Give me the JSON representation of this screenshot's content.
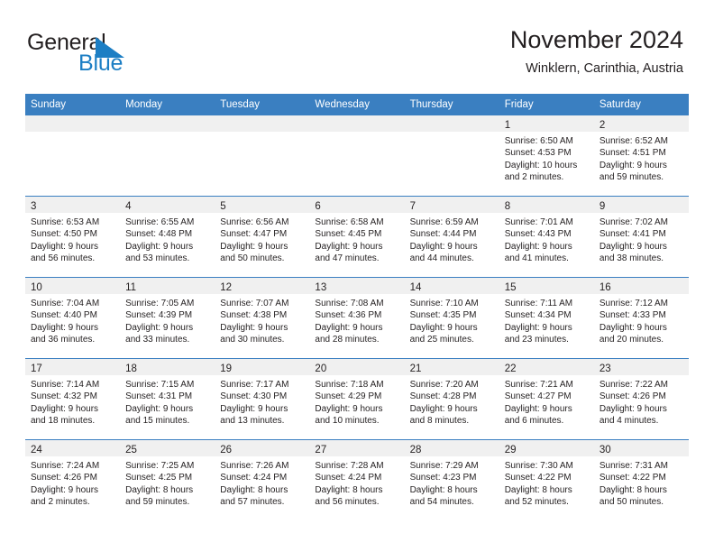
{
  "brand": {
    "name_part1": "General",
    "name_part2": "Blue",
    "accent_color": "#1c7ec4",
    "logo_icon": "triangle-flag-icon"
  },
  "header": {
    "title": "November 2024",
    "subtitle": "Winklern, Carinthia, Austria"
  },
  "theme": {
    "header_row_bg": "#3a7fc1",
    "daynum_band_bg": "#f0f0f0",
    "text_color": "#231f20"
  },
  "weekdays": [
    "Sunday",
    "Monday",
    "Tuesday",
    "Wednesday",
    "Thursday",
    "Friday",
    "Saturday"
  ],
  "labels": {
    "sunrise": "Sunrise:",
    "sunset": "Sunset:",
    "daylight": "Daylight:"
  },
  "weeks": [
    [
      {
        "day": "",
        "sunrise": "",
        "sunset": "",
        "daylight_1": "",
        "daylight_2": ""
      },
      {
        "day": "",
        "sunrise": "",
        "sunset": "",
        "daylight_1": "",
        "daylight_2": ""
      },
      {
        "day": "",
        "sunrise": "",
        "sunset": "",
        "daylight_1": "",
        "daylight_2": ""
      },
      {
        "day": "",
        "sunrise": "",
        "sunset": "",
        "daylight_1": "",
        "daylight_2": ""
      },
      {
        "day": "",
        "sunrise": "",
        "sunset": "",
        "daylight_1": "",
        "daylight_2": ""
      },
      {
        "day": "1",
        "sunrise": "Sunrise: 6:50 AM",
        "sunset": "Sunset: 4:53 PM",
        "daylight_1": "Daylight: 10 hours",
        "daylight_2": "and 2 minutes."
      },
      {
        "day": "2",
        "sunrise": "Sunrise: 6:52 AM",
        "sunset": "Sunset: 4:51 PM",
        "daylight_1": "Daylight: 9 hours",
        "daylight_2": "and 59 minutes."
      }
    ],
    [
      {
        "day": "3",
        "sunrise": "Sunrise: 6:53 AM",
        "sunset": "Sunset: 4:50 PM",
        "daylight_1": "Daylight: 9 hours",
        "daylight_2": "and 56 minutes."
      },
      {
        "day": "4",
        "sunrise": "Sunrise: 6:55 AM",
        "sunset": "Sunset: 4:48 PM",
        "daylight_1": "Daylight: 9 hours",
        "daylight_2": "and 53 minutes."
      },
      {
        "day": "5",
        "sunrise": "Sunrise: 6:56 AM",
        "sunset": "Sunset: 4:47 PM",
        "daylight_1": "Daylight: 9 hours",
        "daylight_2": "and 50 minutes."
      },
      {
        "day": "6",
        "sunrise": "Sunrise: 6:58 AM",
        "sunset": "Sunset: 4:45 PM",
        "daylight_1": "Daylight: 9 hours",
        "daylight_2": "and 47 minutes."
      },
      {
        "day": "7",
        "sunrise": "Sunrise: 6:59 AM",
        "sunset": "Sunset: 4:44 PM",
        "daylight_1": "Daylight: 9 hours",
        "daylight_2": "and 44 minutes."
      },
      {
        "day": "8",
        "sunrise": "Sunrise: 7:01 AM",
        "sunset": "Sunset: 4:43 PM",
        "daylight_1": "Daylight: 9 hours",
        "daylight_2": "and 41 minutes."
      },
      {
        "day": "9",
        "sunrise": "Sunrise: 7:02 AM",
        "sunset": "Sunset: 4:41 PM",
        "daylight_1": "Daylight: 9 hours",
        "daylight_2": "and 38 minutes."
      }
    ],
    [
      {
        "day": "10",
        "sunrise": "Sunrise: 7:04 AM",
        "sunset": "Sunset: 4:40 PM",
        "daylight_1": "Daylight: 9 hours",
        "daylight_2": "and 36 minutes."
      },
      {
        "day": "11",
        "sunrise": "Sunrise: 7:05 AM",
        "sunset": "Sunset: 4:39 PM",
        "daylight_1": "Daylight: 9 hours",
        "daylight_2": "and 33 minutes."
      },
      {
        "day": "12",
        "sunrise": "Sunrise: 7:07 AM",
        "sunset": "Sunset: 4:38 PM",
        "daylight_1": "Daylight: 9 hours",
        "daylight_2": "and 30 minutes."
      },
      {
        "day": "13",
        "sunrise": "Sunrise: 7:08 AM",
        "sunset": "Sunset: 4:36 PM",
        "daylight_1": "Daylight: 9 hours",
        "daylight_2": "and 28 minutes."
      },
      {
        "day": "14",
        "sunrise": "Sunrise: 7:10 AM",
        "sunset": "Sunset: 4:35 PM",
        "daylight_1": "Daylight: 9 hours",
        "daylight_2": "and 25 minutes."
      },
      {
        "day": "15",
        "sunrise": "Sunrise: 7:11 AM",
        "sunset": "Sunset: 4:34 PM",
        "daylight_1": "Daylight: 9 hours",
        "daylight_2": "and 23 minutes."
      },
      {
        "day": "16",
        "sunrise": "Sunrise: 7:12 AM",
        "sunset": "Sunset: 4:33 PM",
        "daylight_1": "Daylight: 9 hours",
        "daylight_2": "and 20 minutes."
      }
    ],
    [
      {
        "day": "17",
        "sunrise": "Sunrise: 7:14 AM",
        "sunset": "Sunset: 4:32 PM",
        "daylight_1": "Daylight: 9 hours",
        "daylight_2": "and 18 minutes."
      },
      {
        "day": "18",
        "sunrise": "Sunrise: 7:15 AM",
        "sunset": "Sunset: 4:31 PM",
        "daylight_1": "Daylight: 9 hours",
        "daylight_2": "and 15 minutes."
      },
      {
        "day": "19",
        "sunrise": "Sunrise: 7:17 AM",
        "sunset": "Sunset: 4:30 PM",
        "daylight_1": "Daylight: 9 hours",
        "daylight_2": "and 13 minutes."
      },
      {
        "day": "20",
        "sunrise": "Sunrise: 7:18 AM",
        "sunset": "Sunset: 4:29 PM",
        "daylight_1": "Daylight: 9 hours",
        "daylight_2": "and 10 minutes."
      },
      {
        "day": "21",
        "sunrise": "Sunrise: 7:20 AM",
        "sunset": "Sunset: 4:28 PM",
        "daylight_1": "Daylight: 9 hours",
        "daylight_2": "and 8 minutes."
      },
      {
        "day": "22",
        "sunrise": "Sunrise: 7:21 AM",
        "sunset": "Sunset: 4:27 PM",
        "daylight_1": "Daylight: 9 hours",
        "daylight_2": "and 6 minutes."
      },
      {
        "day": "23",
        "sunrise": "Sunrise: 7:22 AM",
        "sunset": "Sunset: 4:26 PM",
        "daylight_1": "Daylight: 9 hours",
        "daylight_2": "and 4 minutes."
      }
    ],
    [
      {
        "day": "24",
        "sunrise": "Sunrise: 7:24 AM",
        "sunset": "Sunset: 4:26 PM",
        "daylight_1": "Daylight: 9 hours",
        "daylight_2": "and 2 minutes."
      },
      {
        "day": "25",
        "sunrise": "Sunrise: 7:25 AM",
        "sunset": "Sunset: 4:25 PM",
        "daylight_1": "Daylight: 8 hours",
        "daylight_2": "and 59 minutes."
      },
      {
        "day": "26",
        "sunrise": "Sunrise: 7:26 AM",
        "sunset": "Sunset: 4:24 PM",
        "daylight_1": "Daylight: 8 hours",
        "daylight_2": "and 57 minutes."
      },
      {
        "day": "27",
        "sunrise": "Sunrise: 7:28 AM",
        "sunset": "Sunset: 4:24 PM",
        "daylight_1": "Daylight: 8 hours",
        "daylight_2": "and 56 minutes."
      },
      {
        "day": "28",
        "sunrise": "Sunrise: 7:29 AM",
        "sunset": "Sunset: 4:23 PM",
        "daylight_1": "Daylight: 8 hours",
        "daylight_2": "and 54 minutes."
      },
      {
        "day": "29",
        "sunrise": "Sunrise: 7:30 AM",
        "sunset": "Sunset: 4:22 PM",
        "daylight_1": "Daylight: 8 hours",
        "daylight_2": "and 52 minutes."
      },
      {
        "day": "30",
        "sunrise": "Sunrise: 7:31 AM",
        "sunset": "Sunset: 4:22 PM",
        "daylight_1": "Daylight: 8 hours",
        "daylight_2": "and 50 minutes."
      }
    ]
  ]
}
